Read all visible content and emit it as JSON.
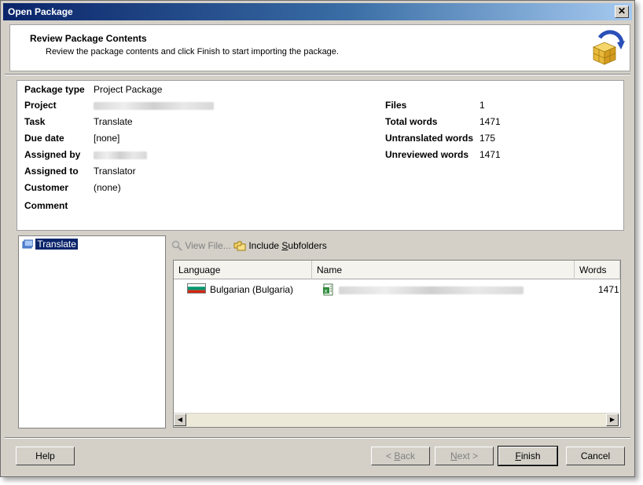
{
  "window": {
    "title": "Open Package"
  },
  "header": {
    "title": "Review Package Contents",
    "subtitle": "Review the package contents and click Finish to start importing the package."
  },
  "info": {
    "package_type_label": "Package type",
    "package_type_value": "Project Package",
    "project_label": "Project",
    "task_label": "Task",
    "task_value": "Translate",
    "due_date_label": "Due date",
    "due_date_value": "[none]",
    "assigned_by_label": "Assigned by",
    "assigned_to_label": "Assigned to",
    "assigned_to_value": "Translator",
    "customer_label": "Customer",
    "customer_value": "(none)",
    "comment_label": "Comment",
    "files_label": "Files",
    "files_value": "1",
    "total_words_label": "Total words",
    "total_words_value": "1471",
    "untranslated_label": "Untranslated words",
    "untranslated_value": "175",
    "unreviewed_label": "Unreviewed words",
    "unreviewed_value": "1471"
  },
  "tree": {
    "item_label": "Translate"
  },
  "toolbar": {
    "view_file": "View File...",
    "include_subfolders": "Include Subfolders"
  },
  "table": {
    "columns": [
      "Language",
      "Name",
      "Words"
    ],
    "rows": [
      {
        "language": "Bulgarian (Bulgaria)",
        "words": "1471"
      }
    ]
  },
  "buttons": {
    "help": "Help",
    "back": "< Back",
    "next": "Next >",
    "finish": "Finish",
    "cancel": "Cancel"
  },
  "colors": {
    "title_start": "#0a246a",
    "title_end": "#a6caf0",
    "selection": "#0a246a"
  }
}
